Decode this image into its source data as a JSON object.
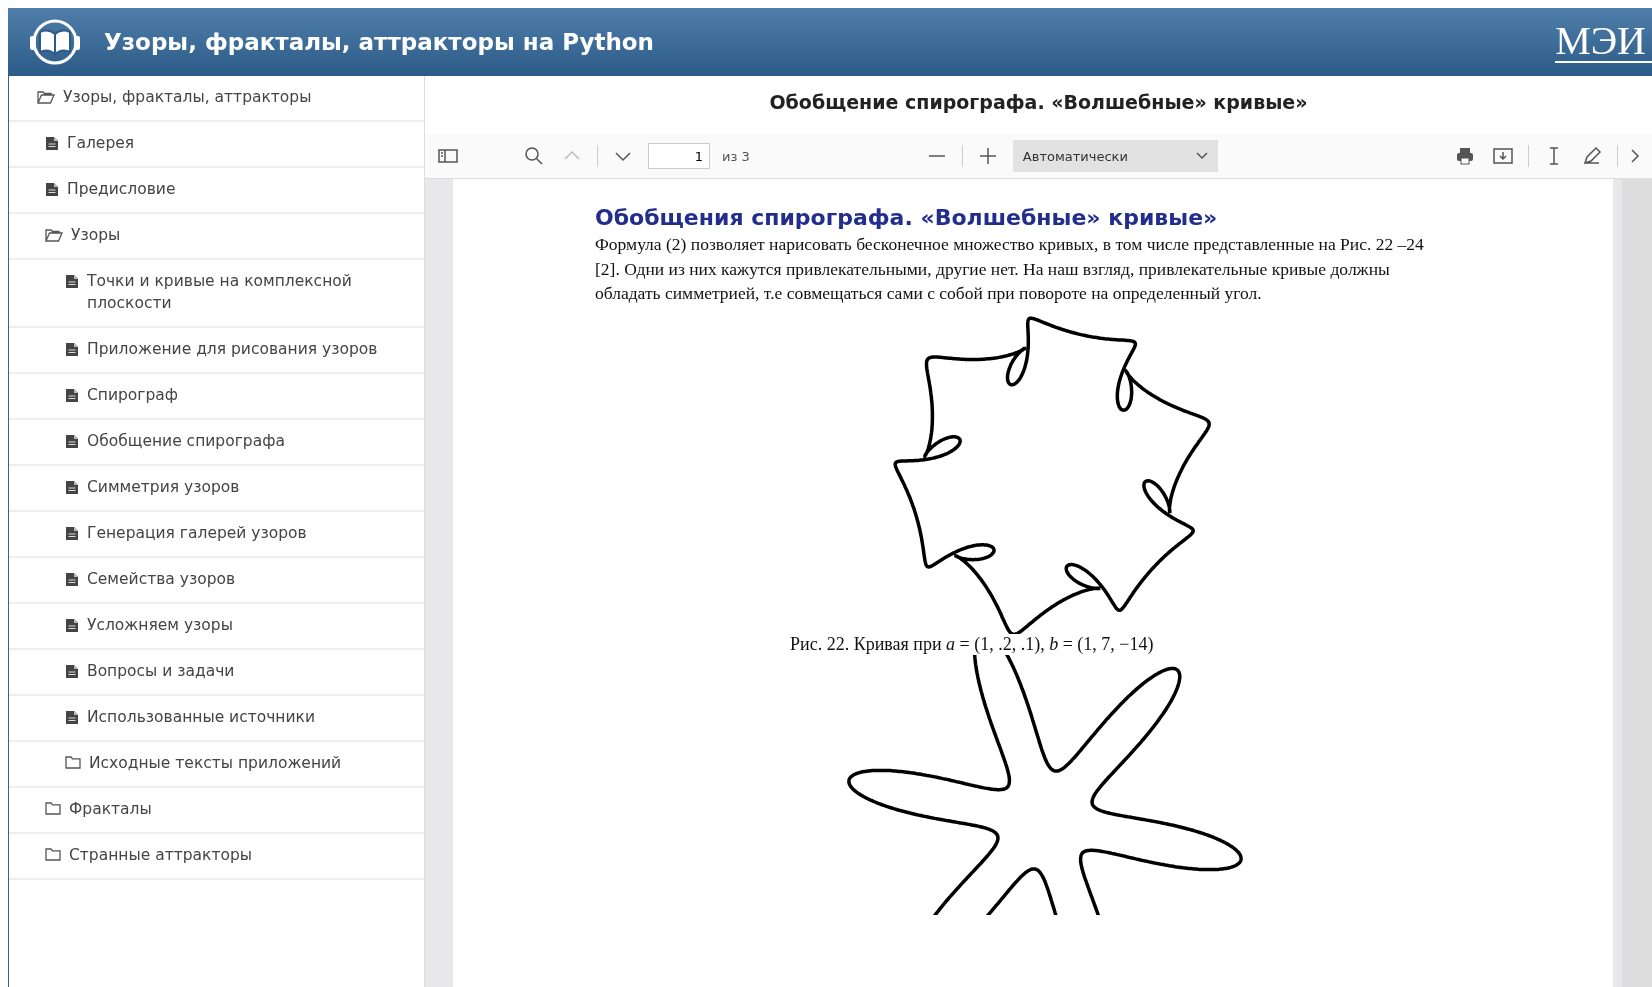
{
  "header": {
    "title": "Узоры, фракталы, аттракторы на Python",
    "logo_text": "МЭИ"
  },
  "sidebar": {
    "items": [
      {
        "label": "Узоры, фракталы, аттракторы",
        "kind": "folder",
        "expanded": true,
        "children": [
          {
            "label": "Галерея",
            "kind": "page"
          },
          {
            "label": "Предисловие",
            "kind": "page"
          },
          {
            "label": "Узоры",
            "kind": "folder",
            "expanded": true,
            "children": [
              {
                "label": "Точки и кривые на комплексной плоскости",
                "kind": "page"
              },
              {
                "label": "Приложение для рисования узоров",
                "kind": "page"
              },
              {
                "label": "Спирограф",
                "kind": "page"
              },
              {
                "label": "Обобщение спирографа",
                "kind": "page"
              },
              {
                "label": "Симметрия узоров",
                "kind": "page"
              },
              {
                "label": "Генерация галерей узоров",
                "kind": "page"
              },
              {
                "label": "Семейства узоров",
                "kind": "page"
              },
              {
                "label": "Усложняем узоры",
                "kind": "page"
              },
              {
                "label": "Вопросы и задачи",
                "kind": "page"
              },
              {
                "label": "Использованные источники",
                "kind": "page"
              },
              {
                "label": "Исходные тексты приложений",
                "kind": "folder",
                "expanded": false
              }
            ]
          },
          {
            "label": "Фракталы",
            "kind": "folder",
            "expanded": false
          },
          {
            "label": "Странные аттракторы",
            "kind": "folder",
            "expanded": false
          }
        ]
      }
    ]
  },
  "main": {
    "title": "Обобщение спирографа. «Волшебные» кривые»",
    "toolbar": {
      "page_field": {
        "value": "1"
      },
      "page_count": "из 3",
      "zoom_select": {
        "value": "Автоматически"
      },
      "previous_disabled": true
    },
    "document": {
      "heading": "Обобщения спирографа. «Волшебные» кривые»",
      "paragraph": "Формула (2) позволяет нарисовать бесконечное множество кривых, в том числе представленные на Рис. 22 –24 [2]. Одни из них кажутся привлекательными, другие нет. На наш взгляд, привлекательные кривые должны обладать симметрией, т.е совмещаться сами с собой при повороте на определенный угол.",
      "figure_caption": "Рис. 22. Кривая при *a* = (1,  .2,  .1), *b* = (1,  7, −14)"
    }
  }
}
